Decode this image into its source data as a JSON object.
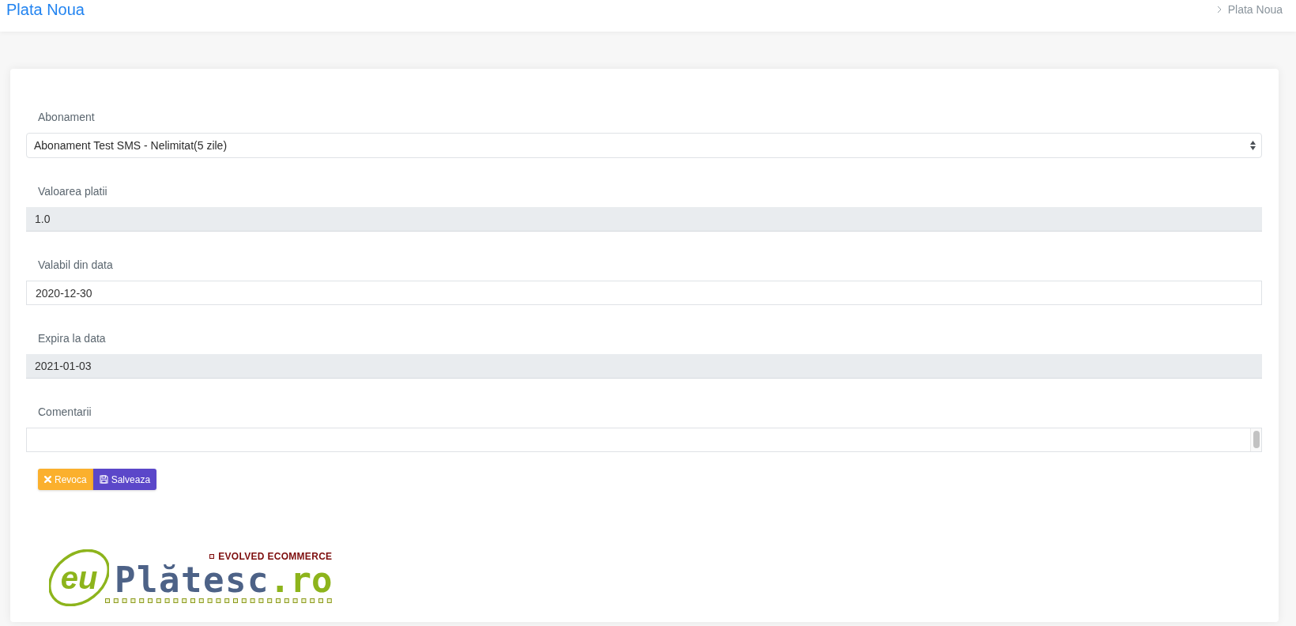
{
  "header": {
    "title": "Plata Noua",
    "breadcrumb": [
      "Plata Noua"
    ]
  },
  "form": {
    "fields": [
      {
        "kind": "select",
        "label": "Abonament",
        "value": "Abonament Test SMS - Nelimitat(5 zile)",
        "readonly": false
      },
      {
        "kind": "input",
        "label": "Valoarea platii",
        "value": "1.0",
        "readonly": true
      },
      {
        "kind": "input",
        "label": "Valabil din data",
        "value": "2020-12-30",
        "readonly": false
      },
      {
        "kind": "input",
        "label": "Expira la data",
        "value": "2021-01-03",
        "readonly": true
      },
      {
        "kind": "textarea",
        "label": "Comentarii",
        "readonly": false
      }
    ],
    "buttons": [
      {
        "kind": "cancel",
        "label": "Revoca"
      },
      {
        "kind": "save",
        "label": "Salveaza"
      }
    ]
  },
  "logo": {
    "tagline": "EVOLVED ECOMMERCE",
    "wordmark": [
      {
        "kind": "prefix",
        "text": "eu"
      },
      {
        "kind": "main",
        "text": "Plătesc"
      },
      {
        "kind": "suffix",
        "text": ".ro"
      }
    ]
  }
}
